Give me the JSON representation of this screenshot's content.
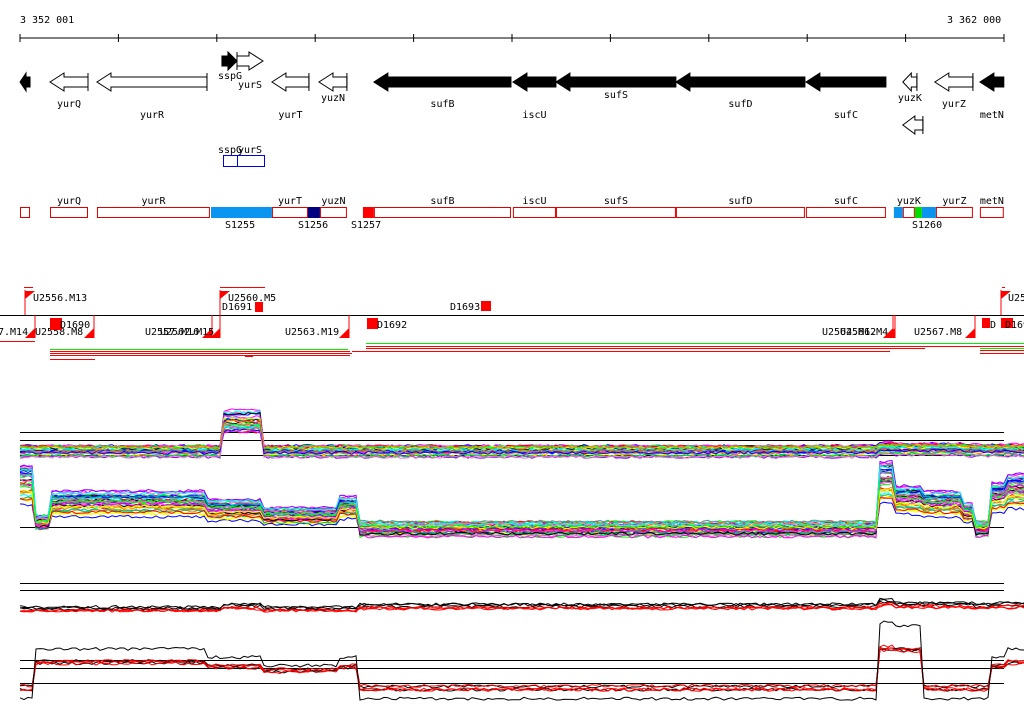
{
  "axis": {
    "start_label": "3 352 001",
    "end_label": "3 362 000",
    "origin": 3352001,
    "span": 9999
  },
  "genes": [
    {
      "name": "",
      "start": 0,
      "end": 102,
      "strand": "-",
      "fill": "black"
    },
    {
      "name": "yurQ",
      "start": 305,
      "end": 691,
      "strand": "-",
      "fill": "white"
    },
    {
      "name": "yurR",
      "start": 782,
      "end": 1900,
      "strand": "-",
      "fill": "white"
    },
    {
      "name": "sspG",
      "start": 2052,
      "end": 2205,
      "strand": "+",
      "fill": "black"
    },
    {
      "name": "yurS",
      "start": 2205,
      "end": 2469,
      "strand": "+",
      "fill": "white"
    },
    {
      "name": "yurT",
      "start": 2560,
      "end": 2936,
      "strand": "-",
      "fill": "white"
    },
    {
      "name": "yuzN",
      "start": 3038,
      "end": 3322,
      "strand": "-",
      "fill": "white"
    },
    {
      "name": "sufB",
      "start": 3596,
      "end": 4989,
      "strand": "-",
      "fill": "black"
    },
    {
      "name": "iscU",
      "start": 5009,
      "end": 5446,
      "strand": "-",
      "fill": "black"
    },
    {
      "name": "sufS",
      "start": 5446,
      "end": 6665,
      "strand": "-",
      "fill": "black"
    },
    {
      "name": "sufD",
      "start": 6665,
      "end": 7976,
      "strand": "-",
      "fill": "black"
    },
    {
      "name": "sufC",
      "start": 7986,
      "end": 8799,
      "strand": "-",
      "fill": "black"
    },
    {
      "name": "yuzK",
      "start": 8971,
      "end": 9114,
      "strand": "-",
      "fill": "white"
    },
    {
      "name": "",
      "start": 8971,
      "end": 9175,
      "strand": "-",
      "fill": "white"
    },
    {
      "name": "yurZ",
      "start": 9296,
      "end": 9683,
      "strand": "-",
      "fill": "white"
    },
    {
      "name": "metN",
      "start": 9754,
      "end": 9997,
      "strand": "-",
      "fill": "black"
    }
  ],
  "small_rnas": {
    "labels": [
      "sspG",
      "yurS"
    ]
  },
  "operon_boxes": [
    {
      "label": "",
      "start": 0,
      "end": 102,
      "color": "#ffffff"
    },
    {
      "label": "yurQ",
      "start": 305,
      "end": 691,
      "color": "#ffffff"
    },
    {
      "label": "yurR",
      "start": 782,
      "end": 1930,
      "color": "#ffffff"
    },
    {
      "label": "",
      "start": 1941,
      "end": 2560,
      "color": "#0a96f0"
    },
    {
      "label": "yurT",
      "start": 2560,
      "end": 2926,
      "color": "#ffffff"
    },
    {
      "label": "",
      "start": 2926,
      "end": 3048,
      "color": "#000080"
    },
    {
      "label": "yuzN",
      "start": 3048,
      "end": 3322,
      "color": "#ffffff"
    },
    {
      "label": "",
      "start": 3485,
      "end": 3596,
      "color": "#ff0000"
    },
    {
      "label": "sufB",
      "start": 3596,
      "end": 4989,
      "color": "#ffffff"
    },
    {
      "label": "iscU",
      "start": 5009,
      "end": 5446,
      "color": "#ffffff"
    },
    {
      "label": "sufS",
      "start": 5446,
      "end": 6665,
      "color": "#ffffff"
    },
    {
      "label": "sufD",
      "start": 6665,
      "end": 7976,
      "color": "#ffffff"
    },
    {
      "label": "sufC",
      "start": 7986,
      "end": 8799,
      "color": "#ffffff"
    },
    {
      "label": "",
      "start": 8880,
      "end": 8971,
      "color": "#0a96f0"
    },
    {
      "label": "yuzK",
      "start": 8971,
      "end": 9093,
      "color": "#ffffff"
    },
    {
      "label": "",
      "start": 9093,
      "end": 9165,
      "color": "#00dd00"
    },
    {
      "label": "",
      "start": 9165,
      "end": 9307,
      "color": "#0a96f0"
    },
    {
      "label": "yurZ",
      "start": 9307,
      "end": 9683,
      "color": "#ffffff"
    },
    {
      "label": "metN",
      "start": 9754,
      "end": 9997,
      "color": "#ffffff"
    }
  ],
  "segments": [
    "S1255",
    "S1256",
    "S1257",
    "S1260"
  ],
  "features": {
    "above": [
      "U2556.M13",
      "U2560.M5",
      "D1691",
      "D1693",
      "U25"
    ],
    "below": [
      "7.M14",
      "U2558.M8",
      "D1690",
      "U2557.M16",
      "U2562.M15",
      "U2563.M19",
      "D1692",
      "U2564.M12",
      "U2566.M4",
      "U2567.M8",
      "D",
      "D1694"
    ]
  },
  "colors": {
    "accent": "#ff0000",
    "up": "#00ee00",
    "axis": "#000000"
  },
  "chart_data": {
    "type": "line",
    "title": "",
    "xlabel": "",
    "ylabel": "",
    "x_breaks_bp": [
      0,
      150,
      300,
      1900,
      2050,
      2470,
      3250,
      3450,
      8700,
      8900,
      9150,
      9560,
      9700,
      9850,
      9999
    ],
    "panel1_top_profile": [
      0,
      0,
      0,
      0,
      3,
      0,
      0,
      0,
      0.3,
      0.2,
      0.2,
      0.1,
      0.1,
      0.1,
      0.1
    ],
    "panel1_bottom_profile": [
      3,
      0,
      1.5,
      1,
      1,
      0.5,
      1.2,
      -0.5,
      3.2,
      1.8,
      1.5,
      0.8,
      -0.5,
      2,
      2.5
    ],
    "panel2_top_profile": [
      0,
      0,
      0,
      0,
      0.2,
      0,
      0,
      0.2,
      0.5,
      0.3,
      0.3,
      0.3,
      0.2,
      0.3,
      0.3
    ],
    "panel2_bottom_profile": [
      -1,
      2,
      2,
      1.5,
      1.5,
      1,
      1.5,
      -1,
      3.6,
      3.4,
      -1,
      -1,
      -1,
      1.5,
      2
    ]
  }
}
